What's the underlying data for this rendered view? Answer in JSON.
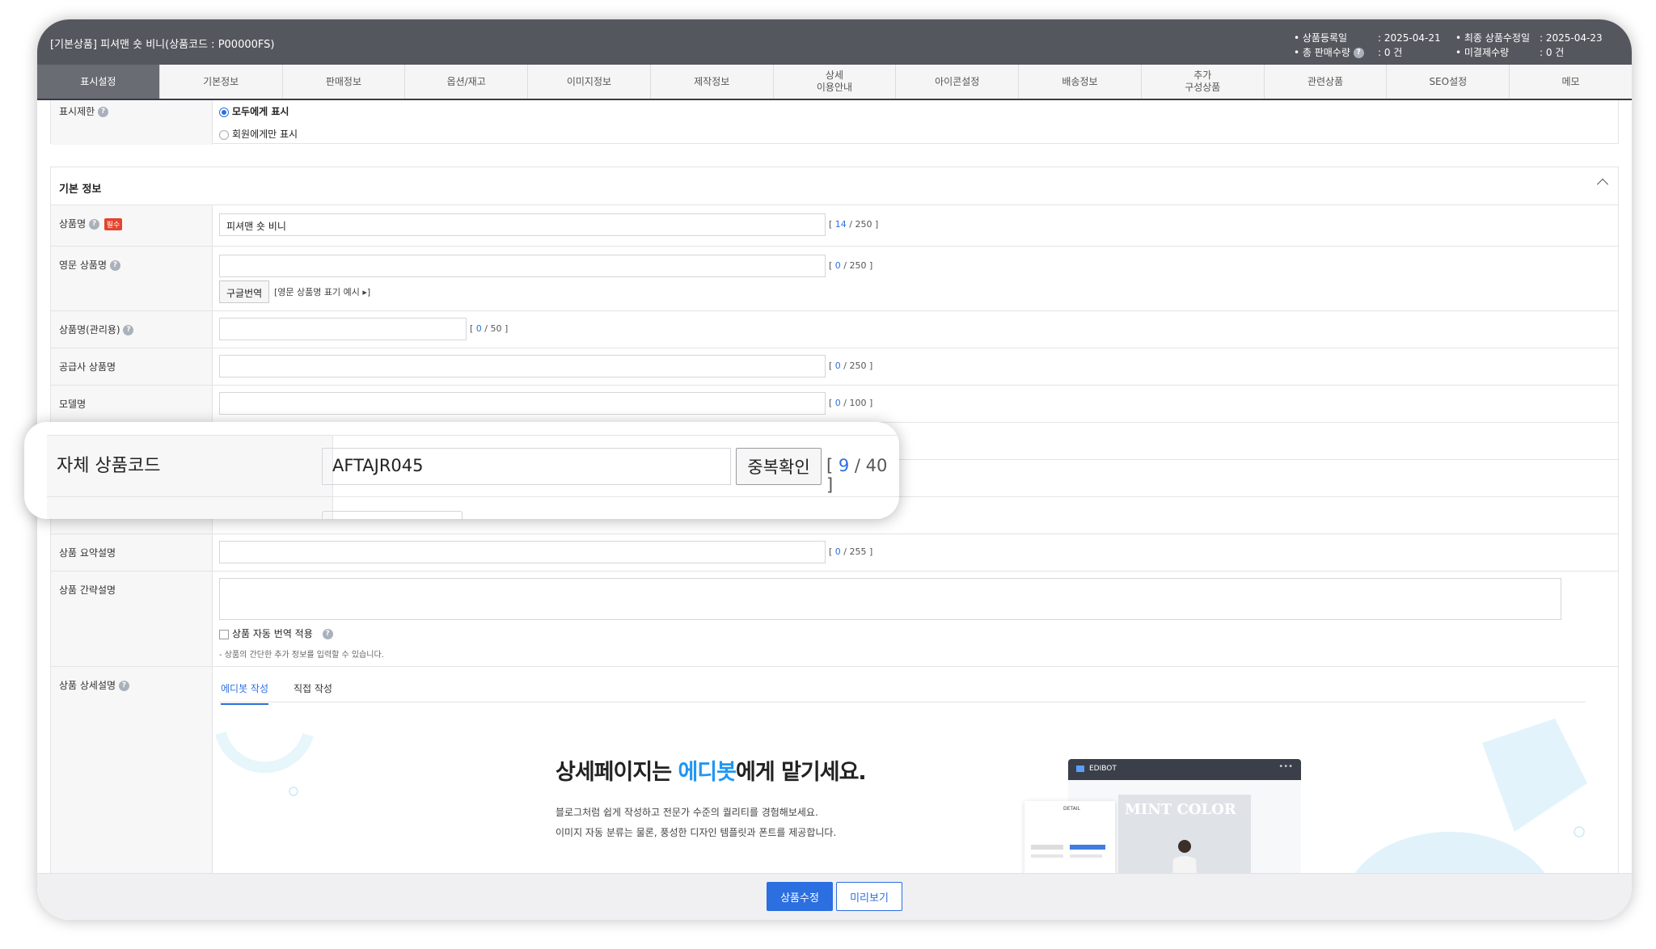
{
  "header": {
    "title": "[기본상품] 피셔맨 숏 비니(상품코드 : P00000FS)",
    "registered_label": "• 상품등록일",
    "registered_value": ": 2025-04-21",
    "total_sales_label": "• 총 판매수량",
    "total_sales_value": ": 0 건",
    "modified_label": "• 최종 상품수정일",
    "modified_value": ": 2025-04-23",
    "unpaid_label": "• 미결제수량",
    "unpaid_value": ": 0 건"
  },
  "tabs": [
    {
      "label": "표시설정"
    },
    {
      "label": "기본정보"
    },
    {
      "label": "판매정보"
    },
    {
      "label": "옵션/재고"
    },
    {
      "label": "이미지정보"
    },
    {
      "label": "제작정보"
    },
    {
      "label": "상세\n이용안내"
    },
    {
      "label": "아이콘설정"
    },
    {
      "label": "배송정보"
    },
    {
      "label": "추가\n구성상품"
    },
    {
      "label": "관련상품"
    },
    {
      "label": "SEO설정"
    },
    {
      "label": "메모"
    }
  ],
  "display": {
    "label": "표시제한",
    "option_all": "모두에게 표시",
    "option_members": "회원에게만 표시"
  },
  "basic": {
    "section_title": "기본 정보",
    "product_name_label": "상품명",
    "required_badge": "필수",
    "product_name_value": "피셔맨 숏 비니",
    "product_name_count_num": "14",
    "product_name_count_max": " / 250 ]",
    "english_name_label": "영문 상품명",
    "english_count_num": "0",
    "english_count_max": " / 250 ]",
    "translate_button": "구글번역",
    "english_example": "[영문 상품명 표기 예시 ▸]",
    "admin_name_label": "상품명(관리용)",
    "admin_count_num": "0",
    "admin_count_max": " / 50 ]",
    "supplier_name_label": "공급사 상품명",
    "supplier_count_num": "0",
    "supplier_count_max": " / 250 ]",
    "model_label": "모델명",
    "model_count_num": "0",
    "model_count_max": " / 100 ]",
    "summary_label": "상품 요약설명",
    "summary_count_num": "0",
    "summary_count_max": " / 255 ]",
    "brief_label": "상품 간략설명",
    "auto_translate": "상품 자동 번역 적용",
    "brief_hint": "- 상품의 간단한 추가 정보를 입력할 수 있습니다.",
    "detail_label": "상품 상세설명",
    "edibot_tab": "에디봇 작성",
    "direct_tab": "직접 작성",
    "promo_headline_a": "상세페이지는 ",
    "promo_headline_accent": "에디봇",
    "promo_headline_b": "에게 맡기세요.",
    "promo_line1": "블로그처럼 쉽게 작성하고 전문가 수준의 퀄리티를 경험해보세요.",
    "promo_line2": "이미지 자동 분류는 물론, 풍성한 디자인 템플릿과 폰트를 제공합니다.",
    "mock_brand": "EDIBOT",
    "mock_detail": "DETAIL",
    "mock_caption": "MINT COLOR"
  },
  "callout": {
    "label": "자체 상품코드",
    "value": "AFTAJR045",
    "dup_button": "중복확인",
    "count_num": "9",
    "count_max": " / 40 ]"
  },
  "footer": {
    "save_button": "상품수정",
    "preview_button": "미리보기"
  },
  "colors": {
    "accent": "#2b6fe0",
    "header_bg": "#55575e",
    "active_tab": "#6a6c73"
  }
}
